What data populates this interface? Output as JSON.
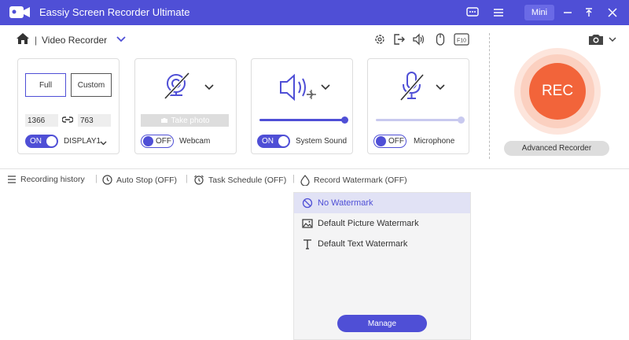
{
  "app": {
    "title": "Eassiy Screen Recorder Ultimate",
    "mini_label": "Mini",
    "accent": "#4f4fd6",
    "rec_color": "#f2643a"
  },
  "toolbar": {
    "breadcrumb_sep": "|",
    "mode_label": "Video Recorder",
    "icons": [
      "settings-icon",
      "export-icon",
      "audio-icon",
      "mouse-icon",
      "f10-hotkey-icon",
      "camera-icon"
    ],
    "hotkey_label": "F10"
  },
  "display_card": {
    "full_label": "Full",
    "custom_label": "Custom",
    "width": "1366",
    "height": "763",
    "toggle": "ON",
    "display_label": "DISPLAY1"
  },
  "webcam_card": {
    "take_photo_label": "Take photo",
    "toggle": "OFF",
    "label": "Webcam"
  },
  "sound_card": {
    "toggle": "ON",
    "label": "System Sound",
    "level": 1.0
  },
  "mic_card": {
    "toggle": "OFF",
    "label": "Microphone",
    "level": 1.0
  },
  "rec": {
    "label": "REC",
    "advanced_label": "Advanced Recorder"
  },
  "bottom_bar": {
    "history": "Recording history",
    "auto_stop": "Auto Stop (OFF)",
    "task_schedule": "Task Schedule (OFF)",
    "watermark": "Record Watermark (OFF)"
  },
  "watermark_menu": {
    "items": [
      "No Watermark",
      "Default Picture Watermark",
      "Default Text Watermark"
    ],
    "selected": "No Watermark",
    "manage_label": "Manage"
  }
}
